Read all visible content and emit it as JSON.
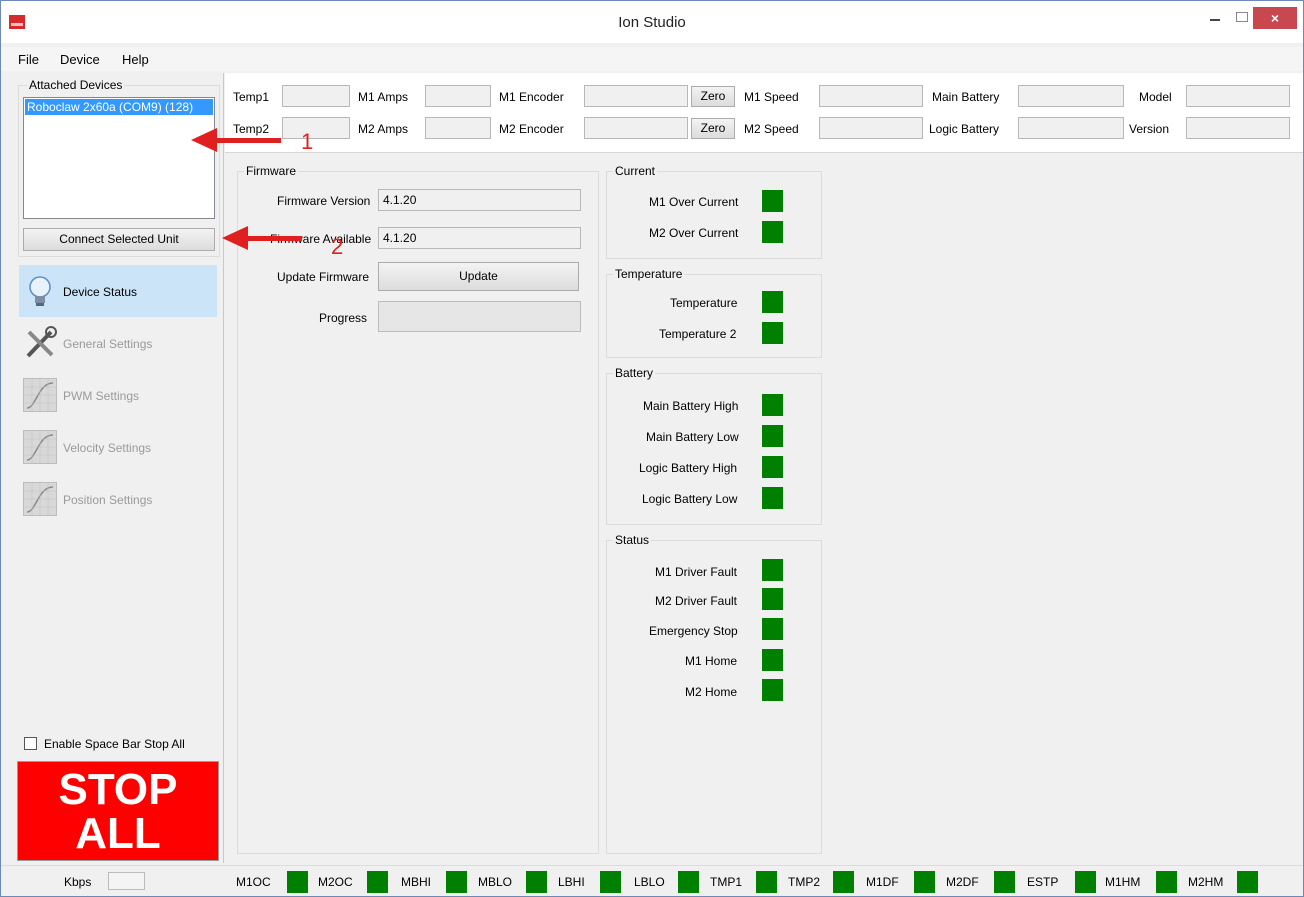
{
  "window": {
    "title": "Ion Studio",
    "close_glyph": "×"
  },
  "menu": [
    "File",
    "Device",
    "Help"
  ],
  "attached_devices": {
    "title": "Attached Devices",
    "items": [
      "Roboclaw 2x60a (COM9) (128)"
    ],
    "connect_label": "Connect Selected Unit"
  },
  "nav": {
    "items": [
      {
        "label": "Device Status",
        "icon": "lightbulb-icon",
        "active": true
      },
      {
        "label": "General Settings",
        "icon": "tools-icon",
        "active": false
      },
      {
        "label": "PWM Settings",
        "icon": "chart-icon",
        "active": false
      },
      {
        "label": "Velocity Settings",
        "icon": "chart-icon",
        "active": false
      },
      {
        "label": "Position Settings",
        "icon": "chart-icon",
        "active": false
      }
    ],
    "spacebar_label": "Enable Space Bar Stop All",
    "stop_line1": "STOP",
    "stop_line2": "ALL"
  },
  "readouts": {
    "temp1": "Temp1",
    "temp2": "Temp2",
    "m1_amps": "M1 Amps",
    "m2_amps": "M2 Amps",
    "m1_encoder": "M1 Encoder",
    "m2_encoder": "M2 Encoder",
    "zero": "Zero",
    "m1_speed": "M1 Speed",
    "m2_speed": "M2 Speed",
    "main_battery": "Main Battery",
    "logic_battery": "Logic Battery",
    "model": "Model",
    "version": "Version"
  },
  "firmware": {
    "title": "Firmware",
    "version_label": "Firmware Version",
    "version_value": "4.1.20",
    "available_label": "Firmware Available",
    "available_value": "4.1.20",
    "update_label": "Update Firmware",
    "update_button": "Update",
    "progress_label": "Progress"
  },
  "current": {
    "title": "Current",
    "items": [
      "M1 Over Current",
      "M2 Over Current"
    ]
  },
  "temperature": {
    "title": "Temperature",
    "items": [
      "Temperature",
      "Temperature 2"
    ]
  },
  "battery": {
    "title": "Battery",
    "items": [
      "Main Battery High",
      "Main Battery Low",
      "Logic Battery High",
      "Logic Battery Low"
    ]
  },
  "status": {
    "title": "Status",
    "items": [
      "M1 Driver Fault",
      "M2 Driver Fault",
      "Emergency Stop",
      "M1 Home",
      "M2 Home"
    ]
  },
  "indicator_color": "#008000",
  "annotations": [
    "1",
    "2"
  ],
  "statusbar": {
    "kbps_label": "Kbps",
    "flags": [
      "M1OC",
      "M2OC",
      "MBHI",
      "MBLO",
      "LBHI",
      "LBLO",
      "TMP1",
      "TMP2",
      "M1DF",
      "M2DF",
      "ESTP",
      "M1HM",
      "M2HM"
    ]
  }
}
